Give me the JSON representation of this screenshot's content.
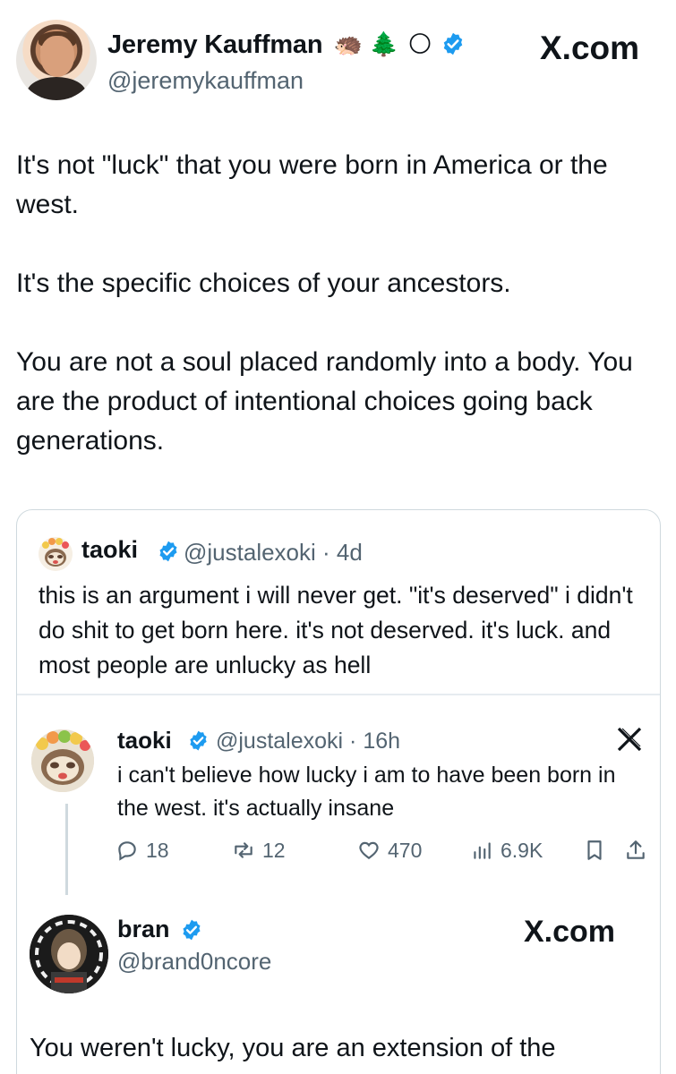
{
  "author": {
    "name": "Jeremy Kauffman",
    "handle": "@jeremykauffman",
    "emojis": [
      "🦔",
      "🌲",
      "🌕"
    ],
    "verified": true,
    "site_label": "X.com"
  },
  "tweet": {
    "paragraphs": [
      "It's not \"luck\" that you were born in America or the west.",
      "It's the specific choices of your ancestors.",
      "You are not a soul placed randomly into a body. You are the product of intentional choices going back generations."
    ]
  },
  "quote": {
    "name": "taoki",
    "handle_time": "@justalexoki · 4d",
    "verified": true,
    "text": "this is an argument i will never get. \"it's deserved\" i didn't do shit to get born here. it's not deserved. it's luck. and most people are unlucky as hell"
  },
  "inner_tweet": {
    "name": "taoki",
    "handle_time": "@justalexoki · 16h",
    "text": "i can't believe how lucky i am to have been born in the west. it's actually insane",
    "stats": {
      "replies": "18",
      "reposts": "12",
      "likes": "470",
      "views": "6.9K"
    }
  },
  "reply_tweet": {
    "name": "bran",
    "handle": "@brand0ncore",
    "site_label": "X.com",
    "text": "You weren't lucky, you are an extension of the"
  },
  "colors": {
    "text": "#0f1419",
    "muted": "#536471",
    "verified_blue": "#1d9bf0",
    "border": "#cfd9de"
  }
}
